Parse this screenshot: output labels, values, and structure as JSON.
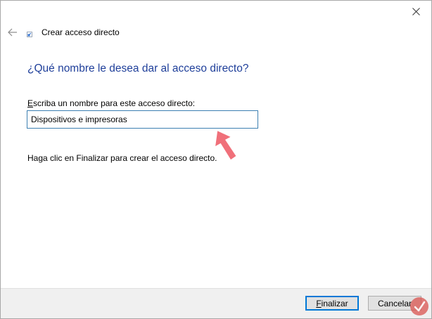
{
  "window": {
    "close_glyph": "✕"
  },
  "header": {
    "back_icon": "arrow-left-icon",
    "wizard_icon": "shortcut-icon",
    "title": "Crear acceso directo"
  },
  "main": {
    "heading": "¿Qué nombre le desea dar al acceso directo?",
    "field_label_mnemonic": "E",
    "field_label_rest": "scriba un nombre para este acceso directo:",
    "name_value": "Dispositivos e impresoras",
    "info": "Haga clic en Finalizar para crear el acceso directo."
  },
  "footer": {
    "finish_mnemonic": "F",
    "finish_rest": "inalizar",
    "cancel_label": "Cancelar"
  },
  "colors": {
    "heading": "#1f3f9a",
    "input_border": "#3c7fb1",
    "default_button_border": "#0078d7",
    "annotation_arrow": "#f0707a"
  }
}
